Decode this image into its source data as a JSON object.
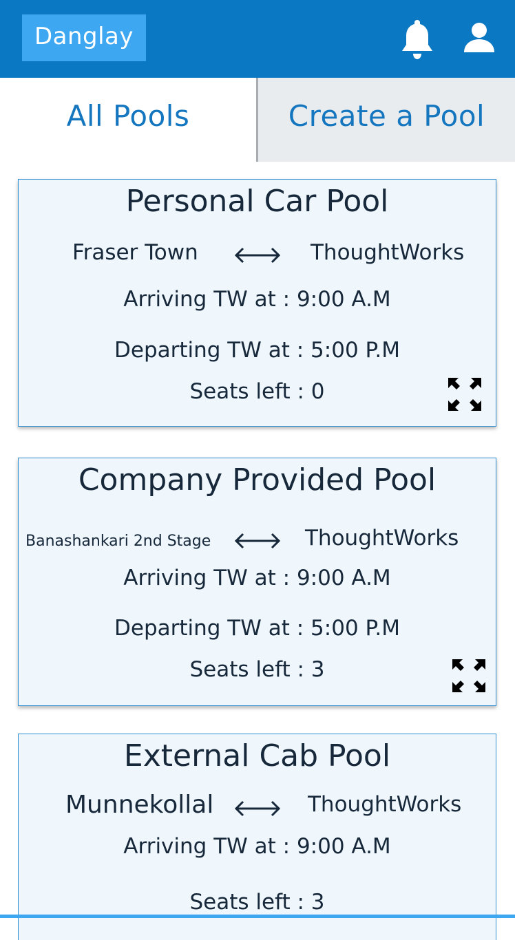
{
  "header": {
    "brand_label": "Danglay",
    "bell_icon": "bell-icon",
    "user_icon": "user-icon",
    "colors": {
      "bar": "#0A78C2",
      "brand_bg": "#3DA7F2"
    }
  },
  "tabs": [
    {
      "label": "All Pools",
      "active": true
    },
    {
      "label": "Create a Pool",
      "active": false
    }
  ],
  "pools": [
    {
      "title": "Personal Car Pool",
      "from": "Fraser Town",
      "to": "ThoughtWorks",
      "arriving": "Arriving TW at : 9:00 A.M",
      "departing": "Departing TW at : 5:00 P.M",
      "seats": "Seats left : 0",
      "expand_icon": "expand-icon"
    },
    {
      "title": "Company Provided Pool",
      "from": "Banashankari 2nd Stage",
      "to": "ThoughtWorks",
      "arriving": "Arriving TW at : 9:00 A.M",
      "departing": "Departing TW at : 5:00 P.M",
      "seats": "Seats left : 3",
      "expand_icon": "expand-icon"
    },
    {
      "title": "External Cab Pool",
      "from": "Munnekollal",
      "to": "ThoughtWorks",
      "arriving": "Arriving TW at : 9:00 A.M",
      "seats": "Seats left : 3"
    }
  ]
}
